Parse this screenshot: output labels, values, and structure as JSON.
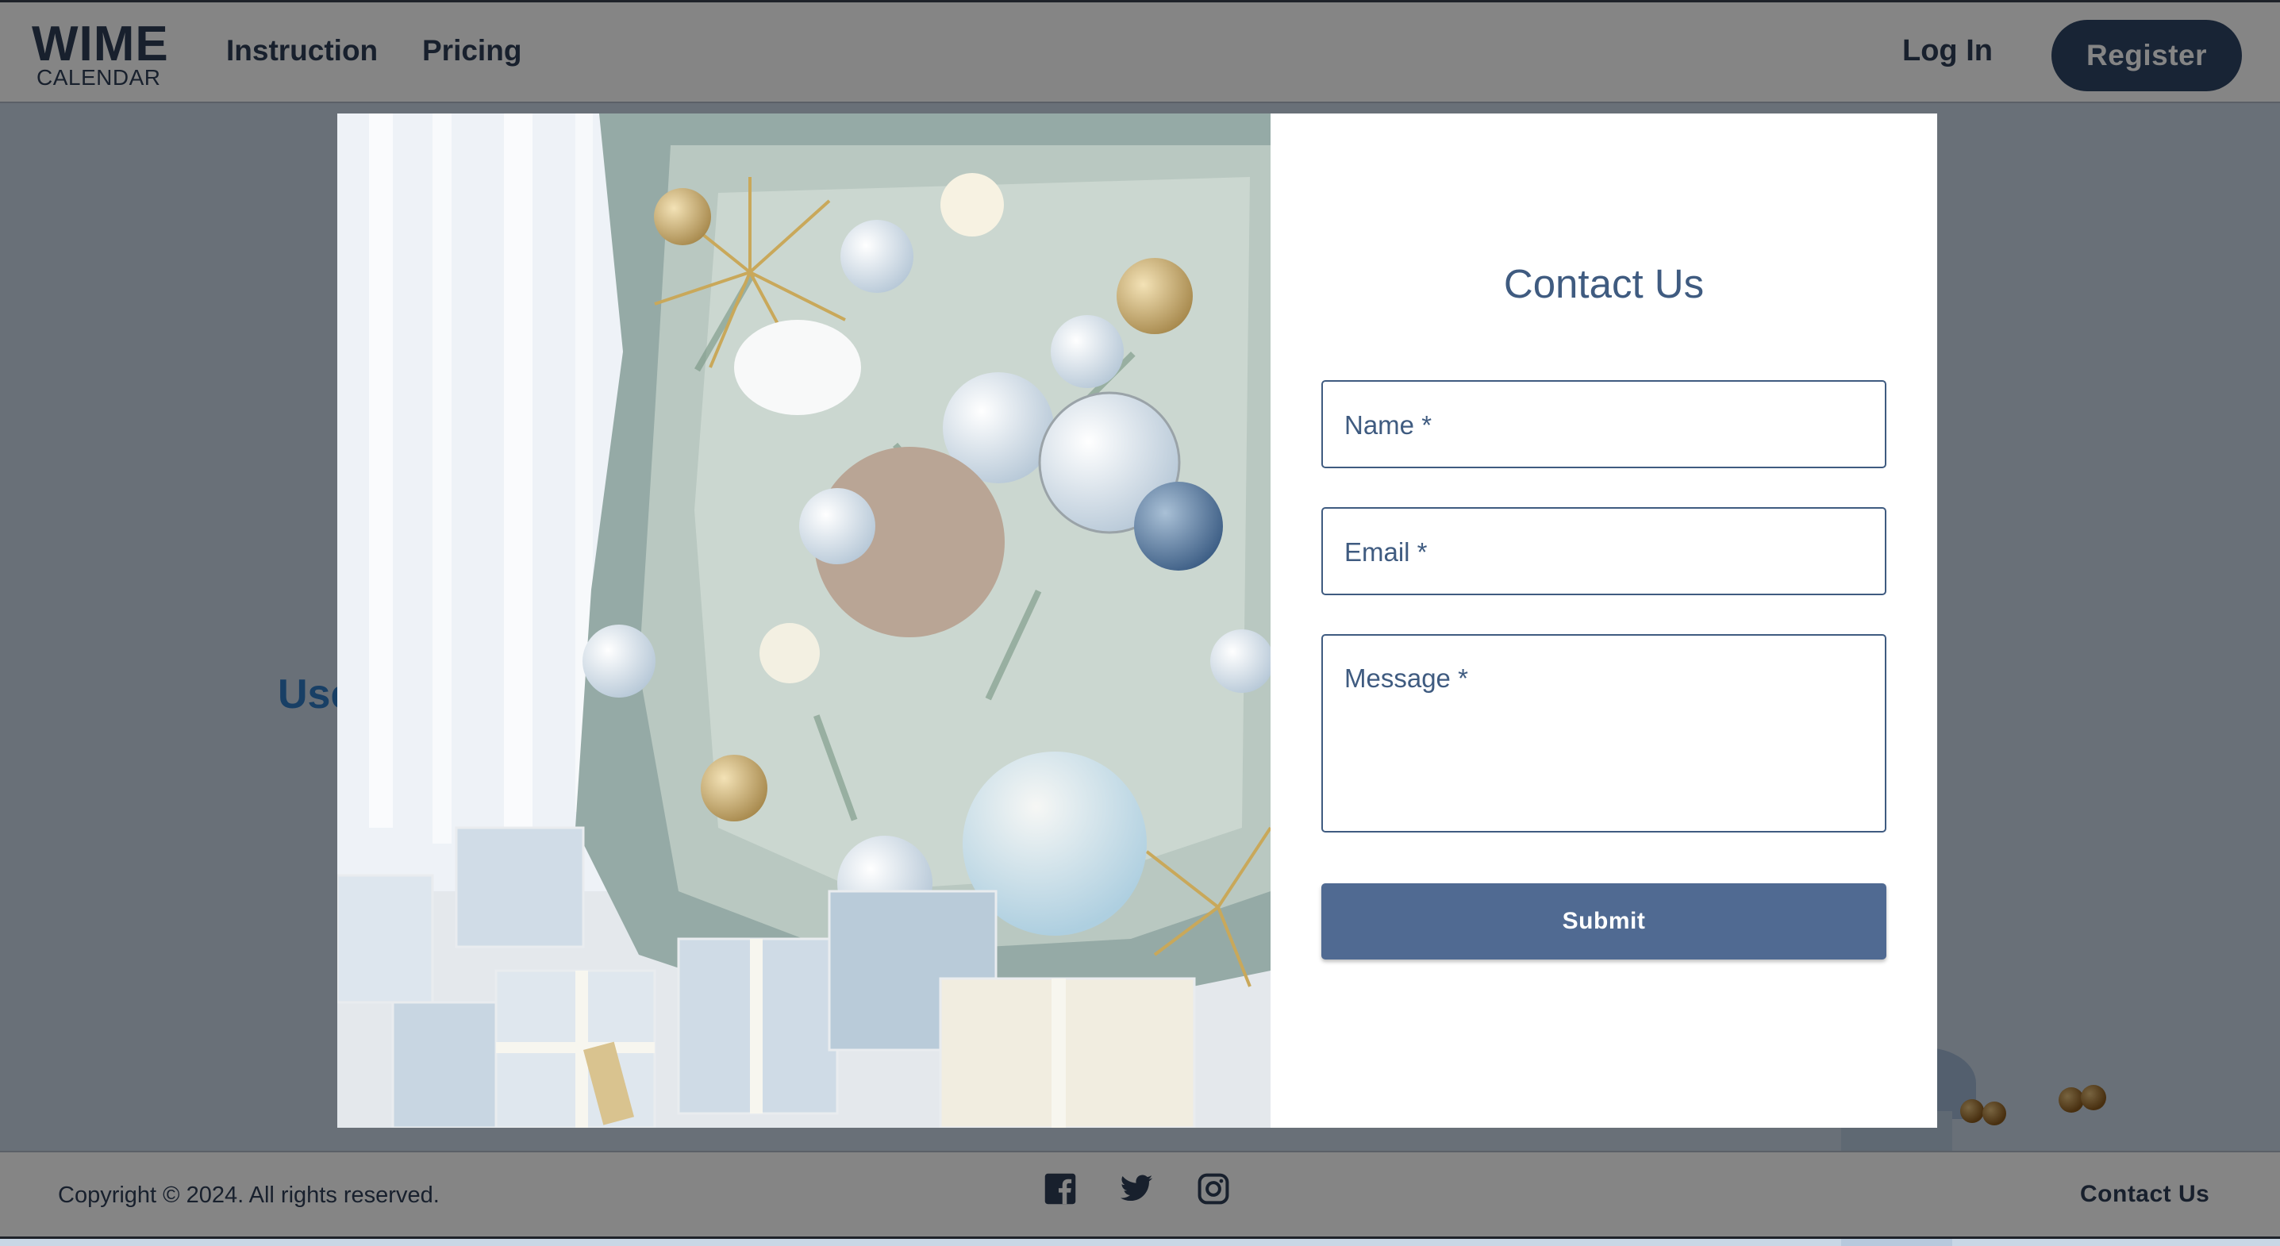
{
  "header": {
    "logo_main": "WIME",
    "logo_sub": "CALENDAR",
    "nav": [
      {
        "label": "Instruction"
      },
      {
        "label": "Pricing"
      }
    ],
    "login_label": "Log In",
    "register_label": "Register"
  },
  "main": {
    "heading_visible": "Use"
  },
  "modal": {
    "title": "Contact Us",
    "fields": {
      "name_label": "Name *",
      "email_label": "Email *",
      "message_label": "Message *"
    },
    "submit_label": "Submit"
  },
  "footer": {
    "copyright": "Copyright © 2024. All rights reserved.",
    "social_icons": [
      "facebook-icon",
      "twitter-icon",
      "instagram-icon"
    ],
    "contact_label": "Contact Us"
  },
  "colors": {
    "brand_dark": "#2e4566",
    "accent_blue": "#3f5b80",
    "submit_bg": "#506a92",
    "overlay": "rgba(0,0,0,0.48)"
  }
}
